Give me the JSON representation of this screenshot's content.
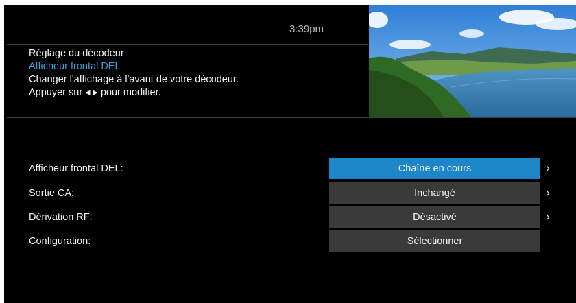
{
  "clock": "3:39pm",
  "info": {
    "breadcrumb": "Réglage du décodeur",
    "item_title": "Afficheur frontal DEL",
    "description": "Changer l'affichage à l'avant de votre décodeur.",
    "hint": "Appuyer sur ◂ ▸ pour modifier."
  },
  "preview": {
    "icon": "live-tv-preview-image"
  },
  "menu": {
    "rows": [
      {
        "label": "Afficheur frontal DEL:",
        "value": "Chaîne en cours",
        "selected": true,
        "has_arrow": true
      },
      {
        "label": "Sortie CA:",
        "value": "Inchangé",
        "selected": false,
        "has_arrow": true
      },
      {
        "label": "Dérivation RF:",
        "value": "Désactivé",
        "selected": false,
        "has_arrow": true
      },
      {
        "label": "Configuration:",
        "value": "Sélectionner",
        "selected": false,
        "has_arrow": false
      }
    ],
    "arrow_glyph": "›"
  },
  "colors": {
    "background": "#000000",
    "highlight": "#1d86c8",
    "value_box": "#3a3a3a",
    "accent_text": "#3d9ddf"
  }
}
